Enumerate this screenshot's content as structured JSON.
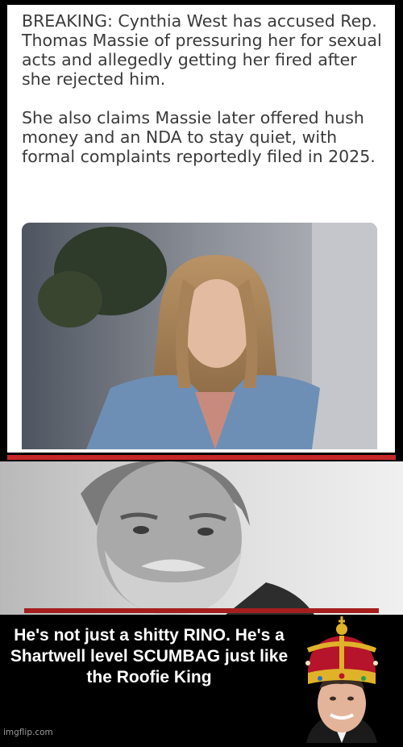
{
  "post": {
    "paragraphs": [
      "BREAKING: Cynthia West has accused Rep. Thomas Massie of pressuring her for sexual acts and allegedly getting her fired after she rejected him.",
      "She also claims Massie later offered hush money and an NDA to stay quiet, with formal complaints reportedly filed in 2025."
    ]
  },
  "caption": {
    "text": "He's not just a shitty RINO. He's a Shartwell level SCUMBAG just like the Roofie King"
  },
  "watermark": "imgflip.com",
  "colors": {
    "background": "#000000",
    "card": "#ffffff",
    "accent_red": "#c62828",
    "crown_gold": "#e0b22a",
    "crown_velvet": "#b5142b"
  }
}
